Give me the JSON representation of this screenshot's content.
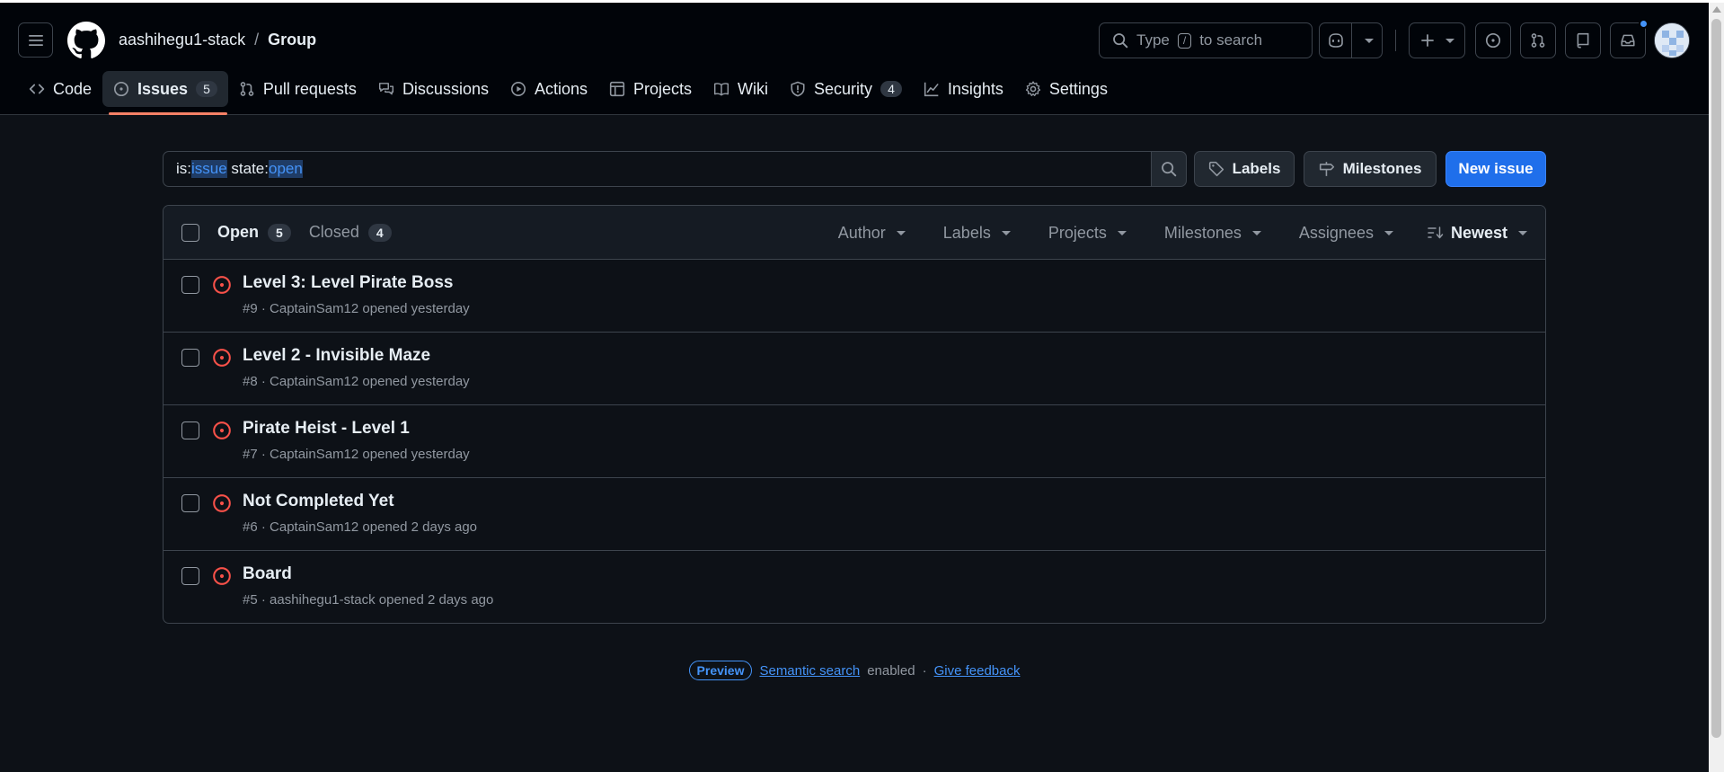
{
  "header": {
    "owner": "aashihegu1-stack",
    "separator": "/",
    "repo": "Group",
    "search_prefix": "Type",
    "search_key": "/",
    "search_suffix": "to search"
  },
  "nav": {
    "tabs": [
      {
        "label": "Code",
        "icon": "code-icon"
      },
      {
        "label": "Issues",
        "icon": "issue-opened-icon",
        "count": "5",
        "active": true
      },
      {
        "label": "Pull requests",
        "icon": "git-pull-request-icon"
      },
      {
        "label": "Discussions",
        "icon": "comment-discussion-icon"
      },
      {
        "label": "Actions",
        "icon": "play-icon"
      },
      {
        "label": "Projects",
        "icon": "table-icon"
      },
      {
        "label": "Wiki",
        "icon": "book-icon"
      },
      {
        "label": "Security",
        "icon": "shield-icon",
        "count": "4"
      },
      {
        "label": "Insights",
        "icon": "graph-icon"
      },
      {
        "label": "Settings",
        "icon": "gear-icon"
      }
    ]
  },
  "filter": {
    "q1": "is:",
    "q2": "issue",
    "q3": " state:",
    "q4": "open",
    "labels_btn": "Labels",
    "milestones_btn": "Milestones",
    "new_issue_btn": "New issue"
  },
  "list": {
    "open_label": "Open",
    "open_count": "5",
    "closed_label": "Closed",
    "closed_count": "4",
    "filters": {
      "author": "Author",
      "labels": "Labels",
      "projects": "Projects",
      "milestones": "Milestones",
      "assignees": "Assignees",
      "sort": "Newest"
    },
    "issues": [
      {
        "title": "Level 3: Level Pirate Boss",
        "meta": "#9 · CaptainSam12 opened yesterday"
      },
      {
        "title": "Level 2 - Invisible Maze",
        "meta": "#8 · CaptainSam12 opened yesterday"
      },
      {
        "title": "Pirate Heist - Level 1",
        "meta": "#7 · CaptainSam12 opened yesterday"
      },
      {
        "title": "Not Completed Yet",
        "meta": "#6 · CaptainSam12 opened 2 days ago"
      },
      {
        "title": "Board",
        "meta": "#5 · aashihegu1-stack opened 2 days ago"
      }
    ]
  },
  "footer": {
    "badge": "Preview",
    "link1": "Semantic search",
    "text": "enabled",
    "dot": "·",
    "link2": "Give feedback"
  },
  "colors": {
    "accent": "#4493f8",
    "open_issue": "#f85149",
    "primary_button": "#1f6feb",
    "active_tab_underline": "#f78166"
  }
}
